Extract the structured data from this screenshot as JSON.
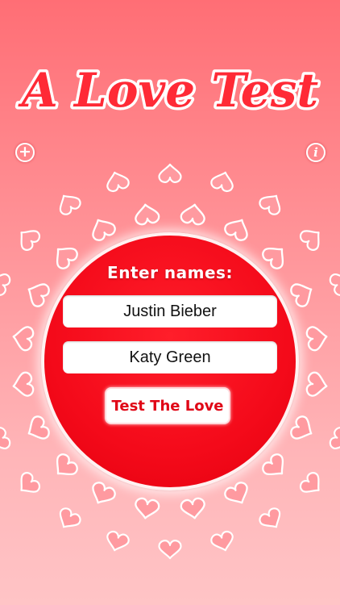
{
  "app": {
    "title": "A Love Test"
  },
  "toolbar": {
    "add_icon": "plus-icon",
    "add_symbol": "+",
    "info_icon": "info-icon",
    "info_symbol": "i"
  },
  "form": {
    "prompt": "Enter names:",
    "name1_value": "Justin Bieber",
    "name2_value": "Katy Green",
    "submit_label": "Test The Love"
  },
  "colors": {
    "circle": "#f40a1a",
    "heart_dark": "#ef1424",
    "heart_light": "#ff9aa0",
    "button_text": "#e00616"
  },
  "decoration": {
    "icon": "heart-icon"
  }
}
